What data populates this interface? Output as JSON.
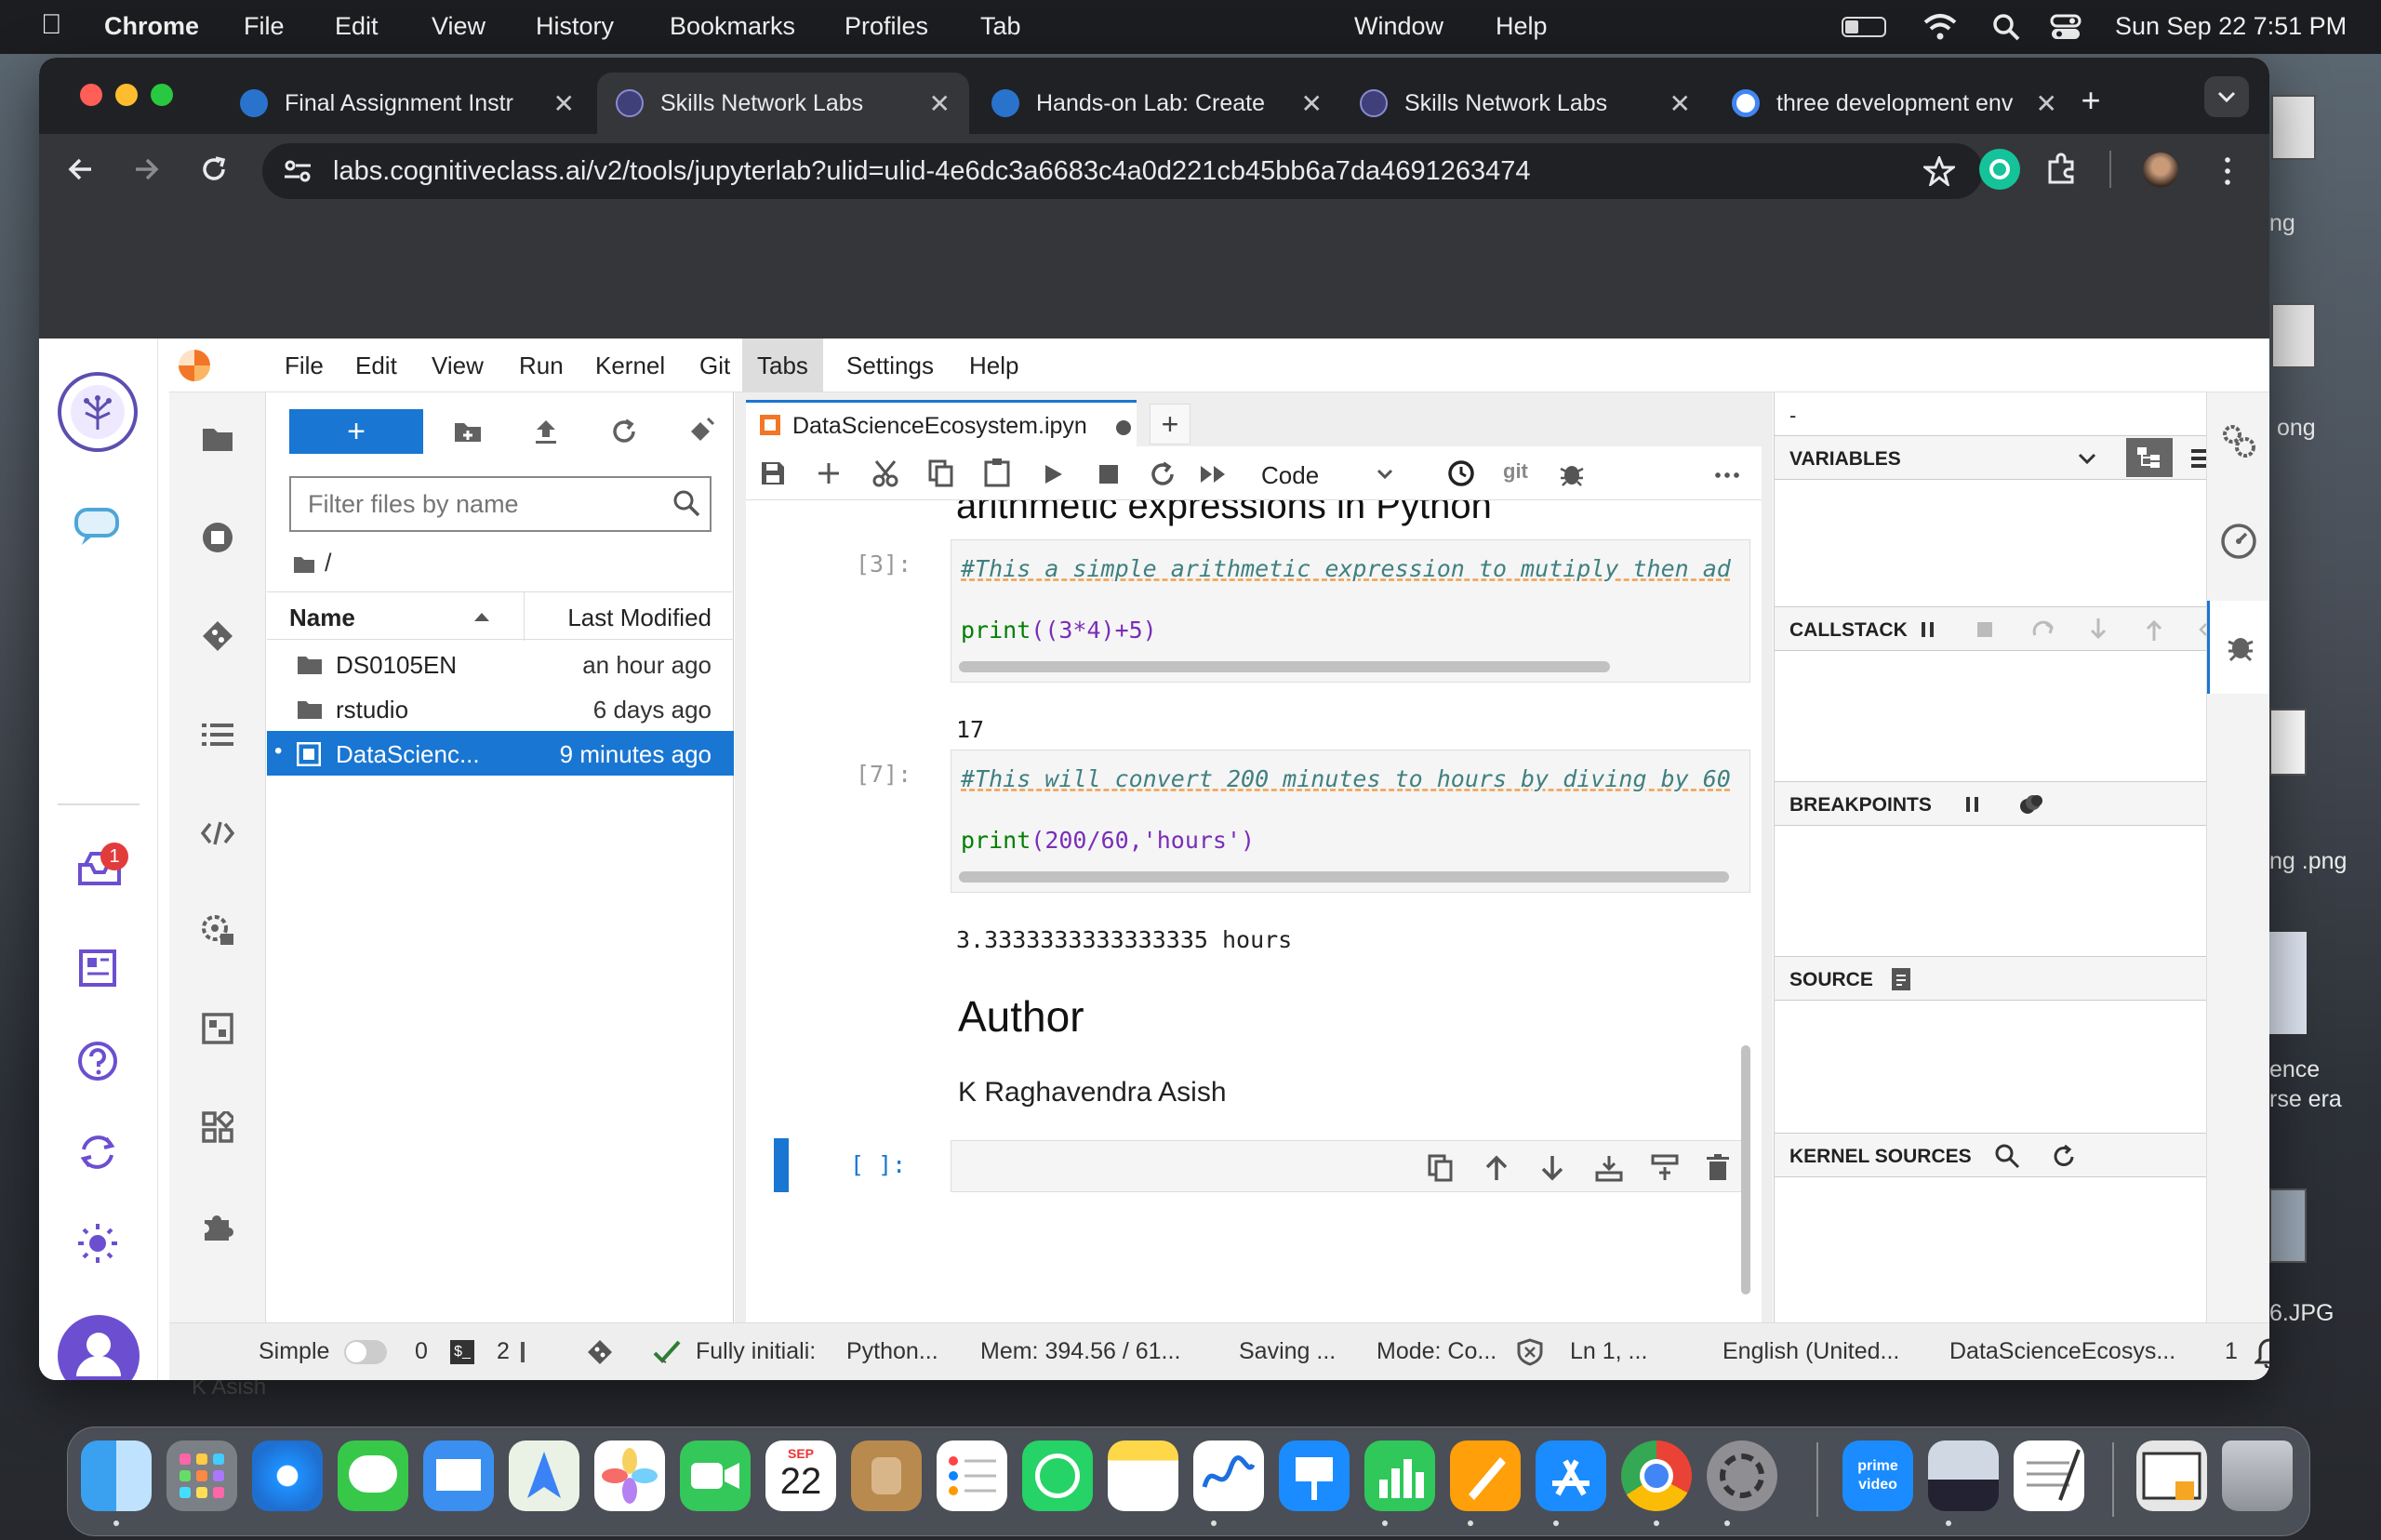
{
  "menubar": {
    "app": "Chrome",
    "items": [
      "File",
      "Edit",
      "View",
      "History",
      "Bookmarks",
      "Profiles",
      "Tab",
      "Window",
      "Help"
    ],
    "datetime": "Sun Sep 22  7:51 PM"
  },
  "desktop": {
    "files": [
      "ng",
      "ong",
      "ng .png",
      "ence",
      "rse era",
      "6.JPG"
    ],
    "bg_user": "K Asish"
  },
  "browser": {
    "tabs": [
      {
        "title": "Final Assignment Instr",
        "icon": "coursera-icon"
      },
      {
        "title": "Skills Network Labs",
        "icon": "skills-network-icon",
        "active": true
      },
      {
        "title": "Hands-on Lab: Create",
        "icon": "coursera-icon"
      },
      {
        "title": "Skills Network Labs",
        "icon": "skills-network-icon"
      },
      {
        "title": "three development env",
        "icon": "google-icon"
      }
    ],
    "url": "labs.cognitiveclass.ai/v2/tools/jupyterlab?ulid=ulid-4e6dc3a6683c4a0d221cb45bb6a7da4691263474"
  },
  "jupyter": {
    "menu": [
      "File",
      "Edit",
      "View",
      "Run",
      "Kernel",
      "Git",
      "Tabs",
      "Settings",
      "Help"
    ],
    "filebrowser": {
      "filter_placeholder": "Filter files by name",
      "path": "/",
      "col_name": "Name",
      "col_modified": "Last Modified",
      "rows": [
        {
          "name": "DS0105EN",
          "modified": "an hour ago",
          "type": "folder"
        },
        {
          "name": "rstudio",
          "modified": "6 days ago",
          "type": "folder"
        },
        {
          "name": "DataScienc...",
          "modified": "9 minutes ago",
          "type": "notebook",
          "selected": true
        }
      ]
    },
    "notebook": {
      "tab_title": "DataScienceEcosystem.ipyn",
      "cell_type": "Code",
      "git_label": "git",
      "heading_partial": "arithmetic expressions in Python",
      "cells": [
        {
          "prompt": "[3]:",
          "comment": "#This a simple arithmetic expression to mutiply then ad",
          "code_print": "print",
          "code_args": "((3*4)+5)",
          "output": "17"
        },
        {
          "prompt": "[7]:",
          "comment": "#This will convert 200 minutes to hours by diving by 60",
          "code_print": "print",
          "code_args": "(200/60,'hours')",
          "output": "3.3333333333333335 hours"
        }
      ],
      "author_heading": "Author",
      "author_name": "K Raghavendra Asish",
      "empty_prompt": "[ ]:"
    },
    "debugger": {
      "top": "-",
      "variables": "VARIABLES",
      "callstack": "CALLSTACK",
      "breakpoints": "BREAKPOINTS",
      "source": "SOURCE",
      "kernel_sources": "KERNEL SOURCES"
    },
    "statusbar": {
      "mode_simple": "Simple",
      "zero": "0",
      "terminals": "2",
      "kernel_status": "Fully initiali:",
      "kernel": "Python...",
      "mem": "Mem: 394.56 / 61...",
      "saving": "Saving ...",
      "mode": "Mode: Co...",
      "position": "Ln 1, ...",
      "language": "English (United...",
      "file": "DataScienceEcosys...",
      "notif_count": "1"
    },
    "inbox_badge": "1"
  },
  "dock": {
    "calendar_month": "SEP",
    "calendar_day": "22",
    "prime_label": "prime video"
  }
}
